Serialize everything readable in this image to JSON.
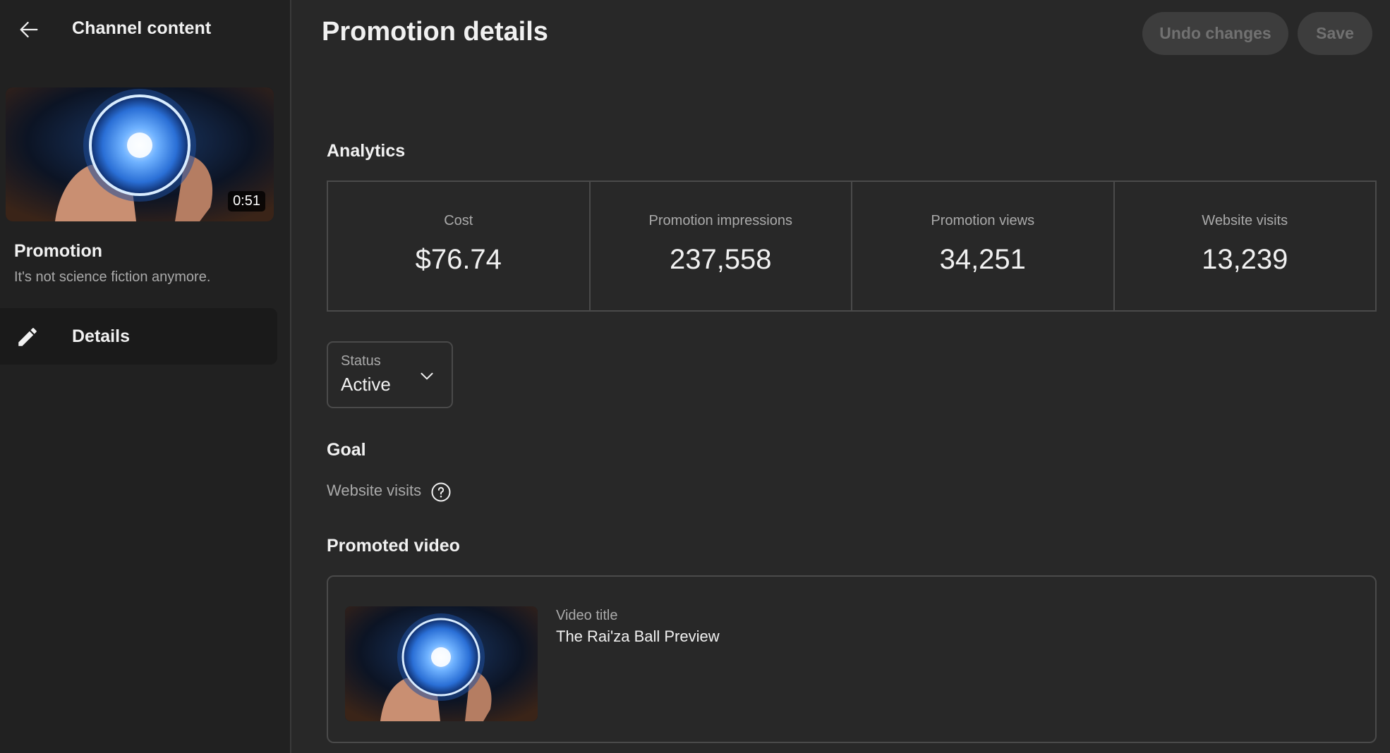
{
  "sidebar": {
    "header_title": "Channel content",
    "thumbnail_duration": "0:51",
    "promotion_title": "Promotion",
    "promotion_subtitle": "It's not science fiction anymore.",
    "nav_items": [
      {
        "label": "Details",
        "icon": "pencil-icon",
        "selected": true
      }
    ]
  },
  "main": {
    "page_title": "Promotion details",
    "actions": {
      "undo_label": "Undo changes",
      "save_label": "Save"
    },
    "analytics": {
      "heading": "Analytics",
      "metrics": [
        {
          "label": "Cost",
          "value": "$76.74"
        },
        {
          "label": "Promotion impressions",
          "value": "237,558"
        },
        {
          "label": "Promotion views",
          "value": "34,251"
        },
        {
          "label": "Website visits",
          "value": "13,239"
        }
      ]
    },
    "status": {
      "label": "Status",
      "value": "Active"
    },
    "goal": {
      "heading": "Goal",
      "value": "Website visits"
    },
    "promoted_video": {
      "heading": "Promoted video",
      "meta_label": "Video title",
      "title": "The Rai'za Ball Preview"
    }
  },
  "colors": {
    "background": "#282828",
    "sidebar_background": "#212121",
    "text_primary": "#f1f1f1",
    "text_secondary": "#aaaaaa",
    "border": "#4a4a4a",
    "disabled_button": "#3d3d3d"
  }
}
